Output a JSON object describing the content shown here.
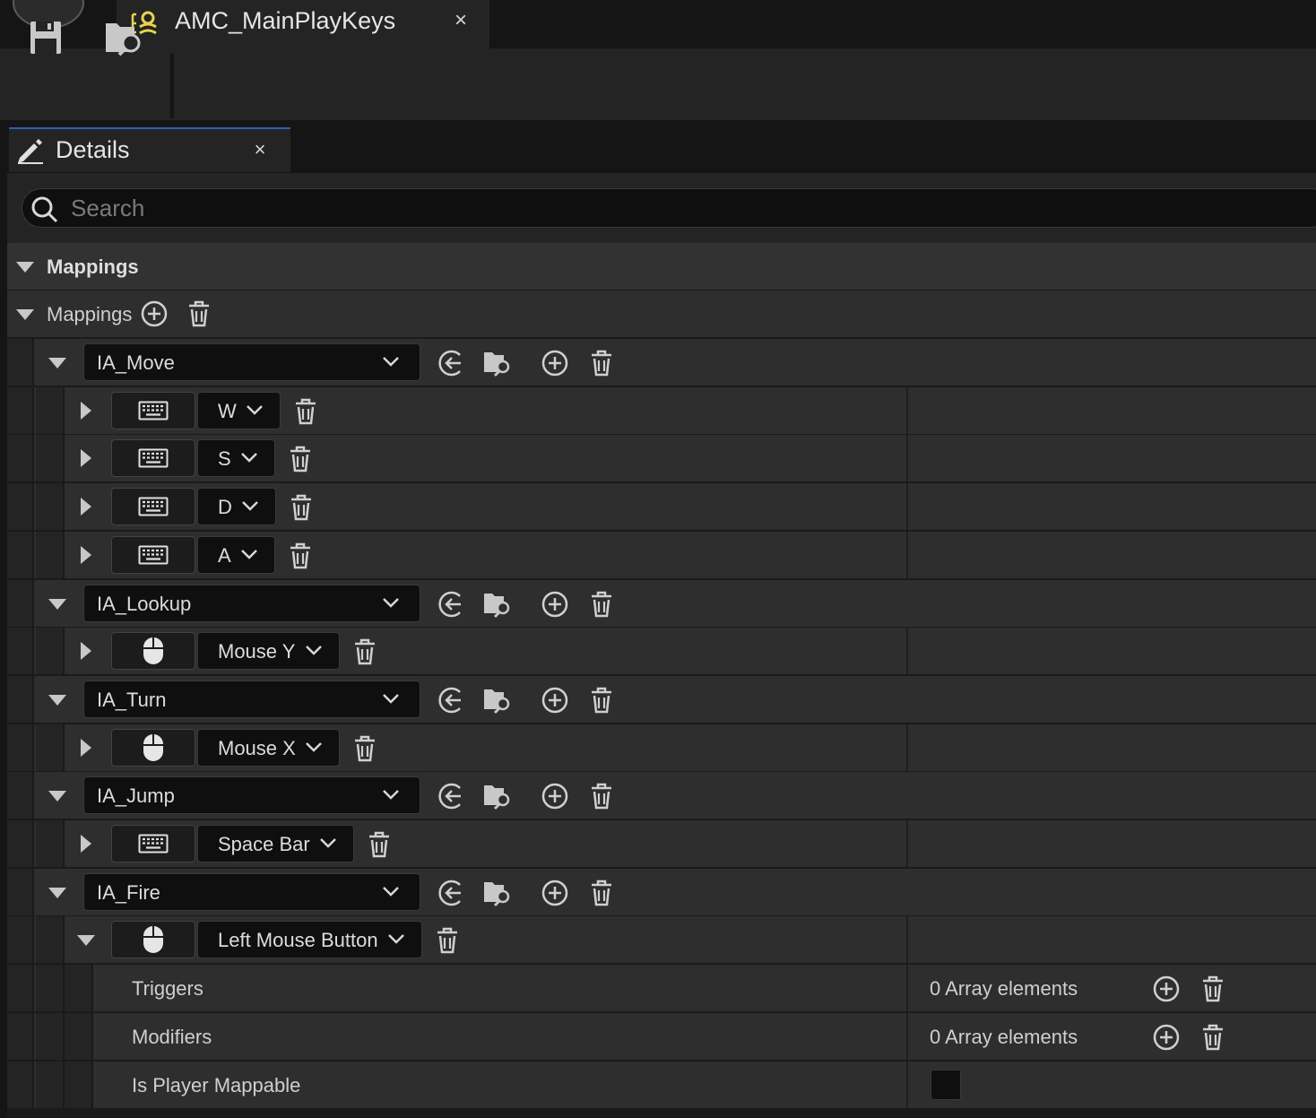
{
  "tab": {
    "title": "AMC_MainPlayKeys",
    "close": "×"
  },
  "panel": {
    "title": "Details",
    "close": "×"
  },
  "search": {
    "placeholder": "Search"
  },
  "category": {
    "label": "Mappings"
  },
  "mappings_array": {
    "label": "Mappings"
  },
  "actions": [
    {
      "name": "IA_Move",
      "keys": [
        {
          "device": "keyboard",
          "key": "W"
        },
        {
          "device": "keyboard",
          "key": "S"
        },
        {
          "device": "keyboard",
          "key": "D"
        },
        {
          "device": "keyboard",
          "key": "A"
        }
      ]
    },
    {
      "name": "IA_Lookup",
      "keys": [
        {
          "device": "mouse",
          "key": "Mouse Y"
        }
      ]
    },
    {
      "name": "IA_Turn",
      "keys": [
        {
          "device": "mouse",
          "key": "Mouse X"
        }
      ]
    },
    {
      "name": "IA_Jump",
      "keys": [
        {
          "device": "keyboard",
          "key": "Space Bar"
        }
      ]
    },
    {
      "name": "IA_Fire",
      "keys": [
        {
          "device": "mouse",
          "key": "Left Mouse Button",
          "expanded": true
        }
      ]
    }
  ],
  "key_props": {
    "triggers": {
      "label": "Triggers",
      "value": "0 Array elements"
    },
    "modifiers": {
      "label": "Modifiers",
      "value": "0 Array elements"
    },
    "player_mappable": {
      "label": "Is Player Mappable",
      "checked": false
    }
  },
  "icons": {
    "tab": "input-mapping-context-icon",
    "save": "save-icon",
    "browse": "browse-to-asset-icon",
    "details": "details-pencil-icon",
    "search": "search-icon",
    "add": "add-circle-icon",
    "delete": "trash-icon",
    "reset": "reset-arrow-icon",
    "keyboard": "keyboard-icon",
    "mouse": "mouse-icon"
  },
  "colors": {
    "background": "#151515",
    "row": "#2e2e2e",
    "accent": "#2f5fb0",
    "tab_icon": "#e8d44d"
  }
}
